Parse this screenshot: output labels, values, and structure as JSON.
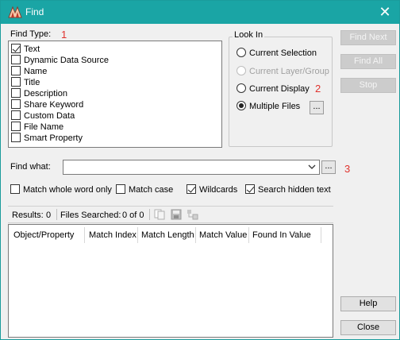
{
  "window": {
    "title": "Find",
    "close_glyph": "✕"
  },
  "find_type": {
    "label": "Find Type:",
    "marker": "1",
    "items": [
      {
        "label": "Text",
        "checked": true
      },
      {
        "label": "Dynamic Data Source",
        "checked": false
      },
      {
        "label": "Name",
        "checked": false
      },
      {
        "label": "Title",
        "checked": false
      },
      {
        "label": "Description",
        "checked": false
      },
      {
        "label": "Share Keyword",
        "checked": false
      },
      {
        "label": "Custom Data",
        "checked": false
      },
      {
        "label": "File Name",
        "checked": false
      },
      {
        "label": "Smart Property",
        "checked": false
      }
    ]
  },
  "look_in": {
    "title": "Look In",
    "marker": "2",
    "options": [
      {
        "label": "Current Selection",
        "selected": false,
        "disabled": false
      },
      {
        "label": "Current Layer/Group",
        "selected": false,
        "disabled": true
      },
      {
        "label": "Current Display",
        "selected": false,
        "disabled": false
      },
      {
        "label": "Multiple Files",
        "selected": true,
        "disabled": false
      }
    ],
    "browse_label": "..."
  },
  "buttons": {
    "find_next": "Find Next",
    "find_all": "Find All",
    "stop": "Stop",
    "help": "Help",
    "close": "Close"
  },
  "find_what": {
    "label": "Find what:",
    "value": "",
    "browse_label": "...",
    "marker": "3"
  },
  "options": {
    "match_whole_word": {
      "label": "Match whole word only",
      "checked": false
    },
    "match_case": {
      "label": "Match case",
      "checked": false
    },
    "wildcards": {
      "label": "Wildcards",
      "checked": true
    },
    "search_hidden": {
      "label": "Search hidden text",
      "checked": true
    }
  },
  "results": {
    "results_label": "Results:",
    "results_count": "0",
    "files_label": "Files Searched:",
    "files_count": "0 of 0",
    "toolbar_icons": [
      "copy-icon",
      "save-icon",
      "export-icon"
    ]
  },
  "table": {
    "columns": [
      "Object/Property",
      "Match Index",
      "Match Length",
      "Match Value",
      "Found In Value"
    ],
    "rows": []
  },
  "colors": {
    "titlebar": "#1aa5a5",
    "marker": "#e0322d",
    "disabled_button": "#cccccc"
  }
}
